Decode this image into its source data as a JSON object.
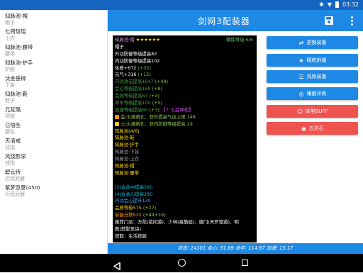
{
  "status_bar": {
    "time": "03:32",
    "icons": [
      "bluetooth-icon",
      "wifi-icon",
      "battery-icon"
    ]
  },
  "toolbar": {
    "title": "剑网3配装器",
    "save_icon": "save-icon",
    "menu_icon": "more-vert-icon"
  },
  "sidebar": {
    "items": [
      {
        "name": "知脉池·帽",
        "sub": "帽子"
      },
      {
        "name": "七窍珑瑶",
        "sub": "上衣"
      },
      {
        "name": "知脉池·腰带",
        "sub": "腰带"
      },
      {
        "name": "知脉池·护手",
        "sub": "护腕"
      },
      {
        "name": "汰金垂柳",
        "sub": "下装"
      },
      {
        "name": "知脉池·鞋",
        "sub": "鞋子"
      },
      {
        "name": "元延璐",
        "sub": "项链"
      },
      {
        "name": "已悟坠",
        "sub": "腰坠"
      },
      {
        "name": "天清戒",
        "sub": "戒指"
      },
      {
        "name": "风绕影深",
        "sub": "戒指"
      },
      {
        "name": "碧云待",
        "sub": "近程武器"
      },
      {
        "name": "紫梦忽意(450)",
        "sub": "近程武器"
      }
    ]
  },
  "panel": {
    "header_name": "知脉池·帽",
    "header_stars": "★★★★★★",
    "refine_level": "精炼等级:6/6",
    "slot": "帽子",
    "attrs": [
      "外功防御等级提高82",
      "内功防御等级提高102",
      "体质+672",
      "(+32)",
      "元气+316",
      "(+15)",
      "内功攻击提高1047",
      "(+49)",
      "会心等级提高168",
      "(+8)",
      "会效等级提高67",
      "(+3)",
      "命中等级提高100",
      "(+5)",
      "加速等级提高60",
      "(+3)",
      "【↑ 七品神化】",
      "金/土撞断孔：获外提高气血上限 146",
      "土/火撞断孔：获内防御等级提高 29"
    ],
    "set_name": "知脉池(4/6)",
    "set_items": [
      "知脉池·鞋",
      "知脉池·护手",
      "知脉池·下装",
      "知脉池·上衣",
      "知脉池·帽",
      "知脉池·腰带"
    ],
    "set_bonus": [
      "[2]会命中提高280",
      "[4]会会心提高280"
    ],
    "extra": [
      "内功会心提升130",
      "品质等级575",
      "(+27)",
      "装备分数932",
      "(+44+16)",
      "推荐门派：万花(花间游)、少林(易筋经)、唐门(天罗诡道)、明",
      "教(焚影圣诀)",
      "获取：生活技能"
    ]
  },
  "buttons": [
    {
      "label": "更换装备",
      "icon": "switch-icon",
      "color": "#1e88e5"
    },
    {
      "label": "精练附魔",
      "icon": "star-icon",
      "color": "#1e88e5"
    },
    {
      "label": "洗炼装备",
      "icon": "tune-icon",
      "color": "#1e88e5"
    },
    {
      "label": "镶嵌淬炼",
      "icon": "target-icon",
      "color": "#1e88e5"
    },
    {
      "label": "体型BUFF",
      "icon": "person-icon",
      "color": "#ef5350"
    },
    {
      "label": "五彩石",
      "icon": "palette-icon",
      "color": "#ef5350"
    }
  ],
  "info_bar": {
    "text": "攻击: 24101 会心: 51.69 命中: 114.67 加速: 15.17"
  },
  "nav": {
    "back_icon": "back-icon",
    "home_icon": "home-icon",
    "recent_icon": "recent-apps-icon"
  }
}
